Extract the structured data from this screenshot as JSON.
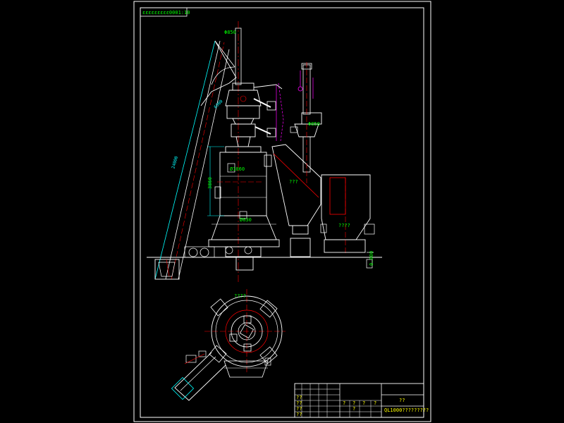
{
  "drawing": {
    "header_label": "ɛɛɛɛɛɛɛɛɛ0001:10",
    "annotations": {
      "top_pipe": "Φ850",
      "conveyor_mid": "6300",
      "conveyor_long": "24000",
      "mill_body": "Ø1060",
      "mill_height": "3860",
      "mill_base": "Ø630",
      "pipe_right": "Φ850",
      "hopper_mid": "???",
      "silo": "????",
      "ground_level": "0.000",
      "plan_top": "????"
    },
    "title_block": {
      "title_cell": "??",
      "drawing_no": "QL1000?????????",
      "row_labels": [
        "??",
        "??",
        "??",
        "??"
      ],
      "mid_cells": [
        "?",
        "?",
        "?",
        "?",
        "?"
      ]
    }
  },
  "colors": {
    "background": "#000000",
    "frame": "#ffffff",
    "outline": "#ffffff",
    "centerline": "#ff0000",
    "dimension": "#00ffff",
    "text_green": "#00ff00",
    "text_yellow": "#ffff00",
    "magenta": "#ff00ff"
  }
}
